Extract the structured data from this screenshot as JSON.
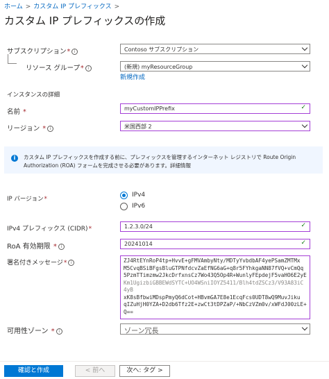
{
  "breadcrumb": {
    "home": "ホーム",
    "separator": ">",
    "current": "カスタム IP プレフィックス"
  },
  "page": {
    "title": "カスタム IP プレフィックスの作成",
    "more": "···"
  },
  "subscription": {
    "label": "サブスクリプション",
    "value": "Contoso サブスクリプション"
  },
  "resource_group": {
    "label": "リソース グループ",
    "value": "(新規) myResourceGroup",
    "create_new": "新規作成"
  },
  "instance": {
    "heading": "インスタンスの詳細"
  },
  "name": {
    "label": "名前",
    "value": "myCustomIPPrefix"
  },
  "region": {
    "label": "リージョン",
    "value": "米国西部 2"
  },
  "banner": {
    "text": "カスタム IP プレフィックスを作成する前に、プレフィックスを管理するインターネット レジストリで Route Origin Authorization (ROA) フォームを完成させる必要があります。詳細情報"
  },
  "ip_version": {
    "label": "IP バージョン",
    "ipv4": "IPv4",
    "ipv6": "IPv6",
    "selected": "IPv4"
  },
  "ipv4_prefix": {
    "label": "IPv4 プレフィックス (CIDR)",
    "value": "1.2.3.0/24"
  },
  "roa_expiry": {
    "label": "RoA 有効期限",
    "value": "20241014"
  },
  "signed_message": {
    "label": "署名付きメッセージ",
    "lines": [
      "ZJ4RtEYnRoP4tp+HvvE+gFMVAmbyNty/MDTyYvbdbAF4yePSamZMTMx",
      "M5CvqBSiBFgsBluGTPNfdcvZaEfNG6aG+q8r5FYhkgaNN87fVQ+vCmQq",
      "5PzmTTimzmw2JkcDrfxnsCz7Wo43Q5Op4R+WunlyFEpdejF5vaHO6E2yE",
      "Km1UgizbiGBBEWdSYTC+UO4WSniIOYZ5411/Blh4tdZSCz3/V93A83iC 4yB",
      "xK8sBfbwiMDspPmyQ6dCot+HBvmGA7E8e1EcqFcs0UDT8wQ9MuvJiku",
      "qIZuHjH0YZA+D2db6Tfz2E+zwCt3tDPZaP/+NbCzVZm0v/xWFdJ00zLE+",
      "Q=="
    ]
  },
  "availability_zone": {
    "label": "可用性ゾーン",
    "placeholder": "ゾーン冗長"
  },
  "footer": {
    "create": "確認と作成",
    "prev": "< 前へ",
    "next": "次へ: タグ >"
  },
  "colors": {
    "accent": "#0078d4",
    "link": "#0066c0",
    "focus_border": "#a43fd6",
    "valid": "#107c10",
    "required": "#a4262c"
  }
}
